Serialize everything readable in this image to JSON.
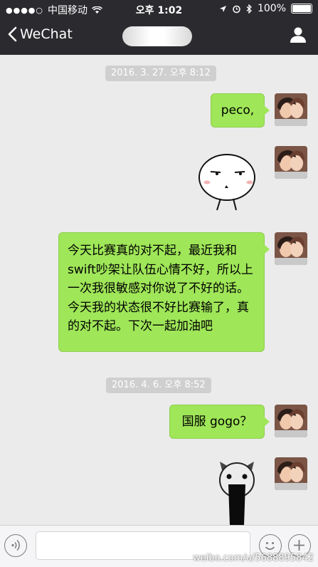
{
  "status_bar": {
    "signal_dots": "●●●●○",
    "carrier": "中国移动",
    "time": "오후 1:02",
    "battery": "100%"
  },
  "nav": {
    "back_label": "WeChat"
  },
  "messages": [
    {
      "type": "time",
      "text": "2016. 3. 27. 오후 8:12"
    },
    {
      "type": "text",
      "text": "peco,"
    },
    {
      "type": "sticker",
      "icon": "blank-stare-face-sticker"
    },
    {
      "type": "text",
      "text": "今天比赛真的对不起，最近我和swift吵架让队伍心情不好，所以上一次我很敏感对你说了不好的话。今天我的状态很不好比赛输了，真的对不起。下次一起加油吧"
    },
    {
      "type": "time",
      "text": "2016. 4. 6. 오후 8:52"
    },
    {
      "type": "text",
      "text": "国服 gogo？"
    },
    {
      "type": "sticker",
      "icon": "shocked-face-sticker"
    }
  ],
  "watermark": "weibo.com/u/5688895842",
  "colors": {
    "bubble_green": "#9fe658",
    "chat_bg": "#ebebeb",
    "bar_dark": "#2b2b2f"
  }
}
